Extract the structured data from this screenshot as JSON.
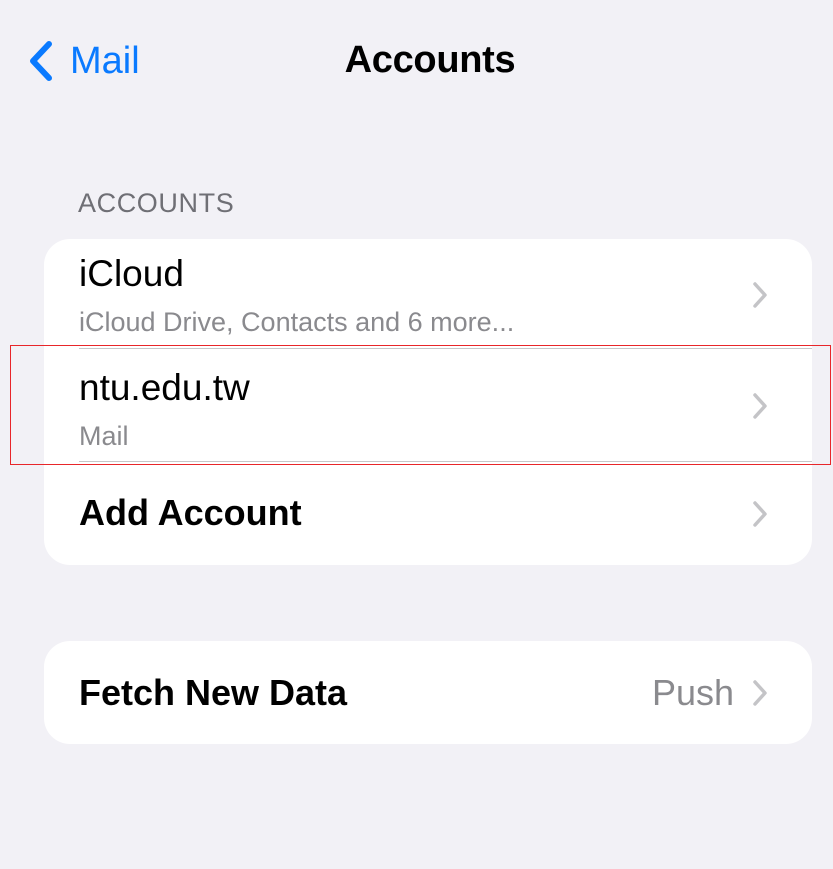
{
  "nav": {
    "back_label": "Mail",
    "title": "Accounts",
    "back_icon": "chevron-left-icon"
  },
  "accounts_section": {
    "header": "ACCOUNTS",
    "rows": [
      {
        "title": "iCloud",
        "subtitle": "iCloud Drive, Contacts and 6 more..."
      },
      {
        "title": "ntu.edu.tw",
        "subtitle": "Mail"
      },
      {
        "title": "Add Account"
      }
    ]
  },
  "fetch_section": {
    "title": "Fetch New Data",
    "value": "Push"
  },
  "colors": {
    "accent": "#0a7aff",
    "background": "#f2f1f6",
    "highlight": "#e8262a",
    "secondary_text": "#8a8a8e"
  }
}
